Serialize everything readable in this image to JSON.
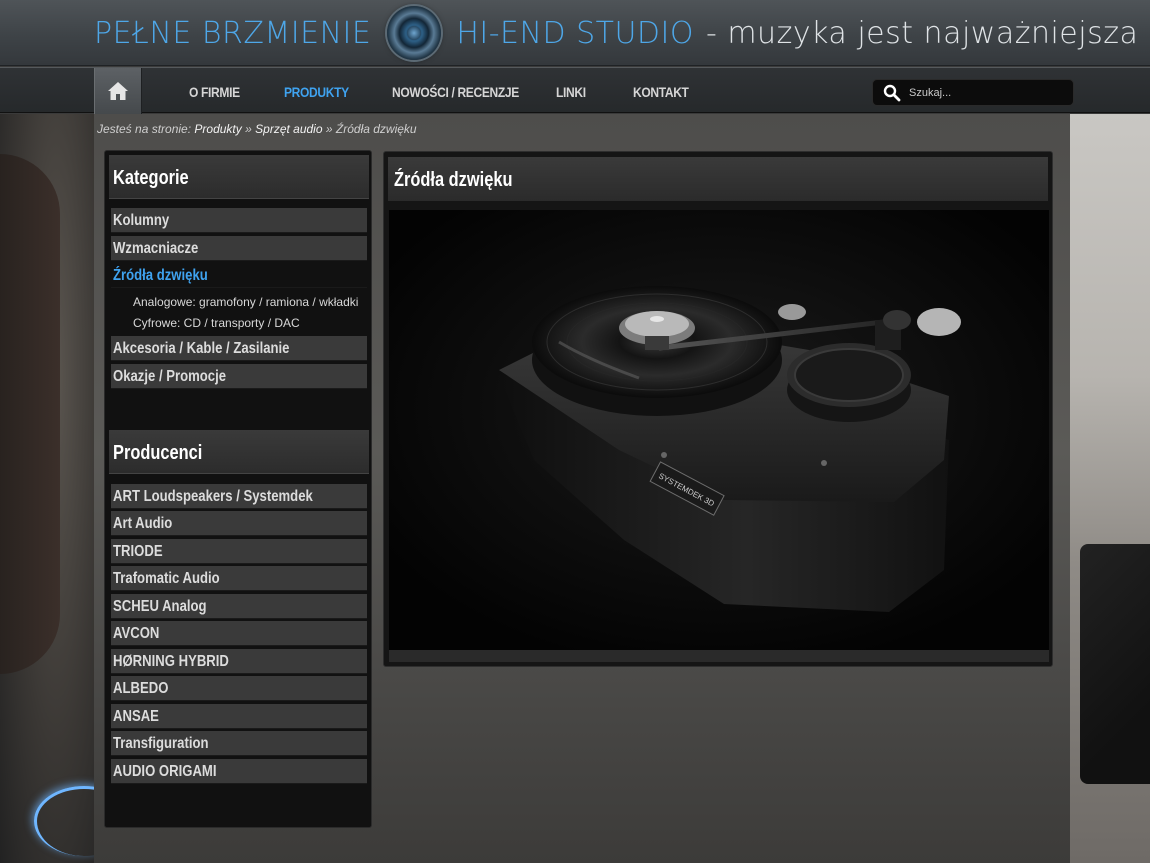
{
  "header": {
    "brand_left": "PEŁNE BRZMIENIE",
    "brand_right": "HI-END STUDIO",
    "tagline": "- muzyka jest najważniejsza"
  },
  "nav": {
    "items": [
      {
        "label": "O FIRMIE",
        "active": false
      },
      {
        "label": "PRODUKTY",
        "active": true
      },
      {
        "label": "NOWOŚCI / RECENZJE",
        "active": false
      },
      {
        "label": "LINKI",
        "active": false
      },
      {
        "label": "KONTAKT",
        "active": false
      }
    ],
    "search_placeholder": "Szukaj..."
  },
  "breadcrumb": {
    "prefix": "Jesteś na stronie:",
    "items": [
      "Produkty",
      "Sprzęt audio",
      "Źródła dzwięku"
    ],
    "separator": "»"
  },
  "categories": {
    "heading": "Kategorie",
    "items": [
      "Kolumny",
      "Wzmacniacze",
      "Źródła dzwięku"
    ],
    "subitems": [
      "Analogowe: gramofony / ramiona / wkładki",
      "Cyfrowe: CD / transporty / DAC"
    ],
    "items_after": [
      "Akcesoria / Kable / Zasilanie",
      "Okazje / Promocje"
    ]
  },
  "producers": {
    "heading": "Producenci",
    "items": [
      "ART Loudspeakers / Systemdek",
      "Art Audio",
      "TRIODE",
      "Trafomatic Audio",
      "SCHEU Analog",
      "AVCON",
      "HØRNING HYBRID",
      "ALBEDO",
      "ANSAE",
      "Transfiguration",
      "AUDIO ORIGAMI"
    ]
  },
  "main": {
    "title": "Źródła dzwięku",
    "image_label": "SYSTEMDEK 3D"
  },
  "colors": {
    "accent": "#3fa3f0",
    "brand_blue": "#4ea7e8"
  }
}
